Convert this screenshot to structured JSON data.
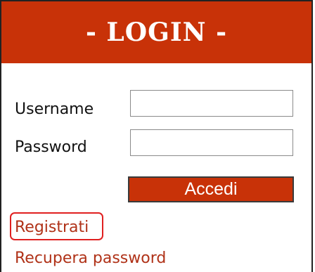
{
  "header": {
    "title": "- LOGIN -"
  },
  "form": {
    "username_label": "Username",
    "username_value": "",
    "password_label": "Password",
    "password_value": "",
    "submit_label": "Accedi"
  },
  "links": {
    "register": "Registrati",
    "recover_password": "Recupera password"
  },
  "colors": {
    "header_background": "#c83208",
    "button_background": "#c83208",
    "link": "#b03218",
    "highlight": "#e02020"
  }
}
